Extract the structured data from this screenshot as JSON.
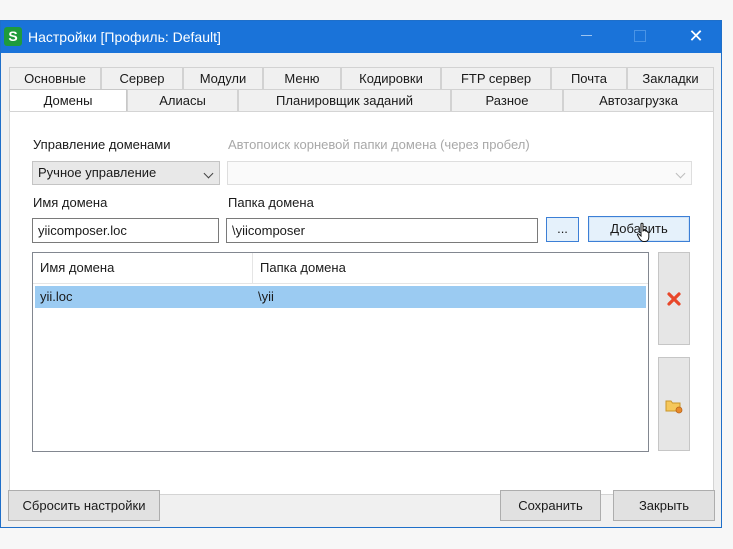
{
  "window": {
    "app_icon_letter": "S",
    "title": "Настройки [Профиль: Default]"
  },
  "tabs": {
    "row1": [
      "Основные",
      "Сервер",
      "Модули",
      "Меню",
      "Кодировки",
      "FTP сервер",
      "Почта",
      "Закладки"
    ],
    "row2": [
      "Домены",
      "Алиасы",
      "Планировщик заданий",
      "Разное",
      "Автозагрузка"
    ],
    "active": "Домены"
  },
  "domains": {
    "management_label": "Управление доменами",
    "management_value": "Ручное управление",
    "autosearch_label": "Автопоиск корневой папки домена (через пробел)",
    "autosearch_value": "",
    "domain_name_label": "Имя домена",
    "domain_name_value": "yiicomposer.loc",
    "domain_folder_label": "Папка домена",
    "domain_folder_value": "\\yiicomposer",
    "browse_label": "...",
    "add_label": "Добавить",
    "table": {
      "columns": [
        "Имя домена",
        "Папка домена"
      ],
      "rows": [
        {
          "name": "yii.loc",
          "folder": "\\yii",
          "selected": true
        }
      ]
    }
  },
  "footer": {
    "reset_label": "Сбросить настройки",
    "save_label": "Сохранить",
    "close_label": "Закрыть"
  },
  "colors": {
    "titlebar": "#1a73d9",
    "selection": "#9bcbf2",
    "delete_icon": "#e8472a"
  },
  "icons": {
    "delete": "red-x-icon",
    "edit": "folder-edit-icon"
  }
}
